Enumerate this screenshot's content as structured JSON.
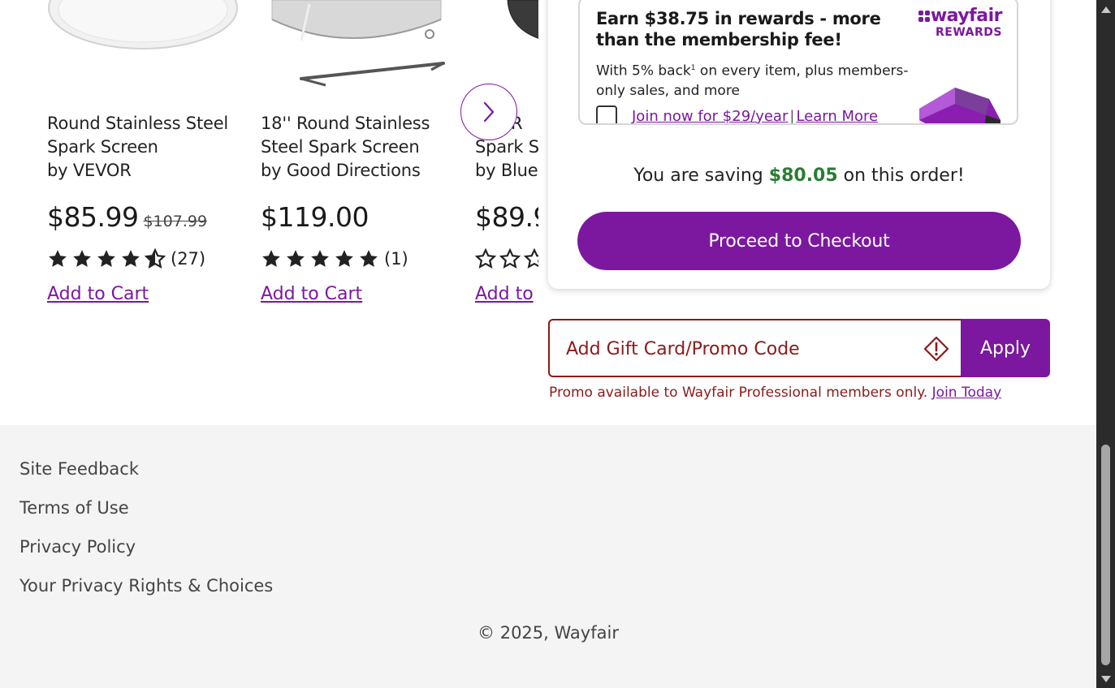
{
  "products": [
    {
      "name_line1": "Round Stainless Steel",
      "name_line2": "Spark Screen",
      "brand": "by VEVOR",
      "price": "$85.99",
      "was_price": "$107.99",
      "rating": 4.5,
      "review_count": "(27)",
      "add_label": "Add to Cart"
    },
    {
      "name_line1": "18'' Round Stainless",
      "name_line2": "Steel Spark Screen",
      "brand": "by Good Directions",
      "price": "$119.00",
      "was_price": "",
      "rating": 5,
      "review_count": "(1)",
      "add_label": "Add to Cart"
    },
    {
      "name_line1": "35'' R",
      "name_line2": "Spark S",
      "brand": "by Blue",
      "price": "$89.9",
      "was_price": "",
      "rating": 0,
      "review_count": "",
      "add_label": "Add to"
    }
  ],
  "carousel": {
    "next_icon": "chevron-right-icon"
  },
  "rewards": {
    "headline": "Earn $38.75 in rewards - more than the membership fee!",
    "desc_part1": "With 5% back",
    "desc_sup": "1",
    "desc_part2": " on every item, plus members-only sales, and more",
    "join_link": "Join now for $29/year",
    "separator": "|",
    "learn_more": "Learn More",
    "logo_word": "wayfair",
    "logo_sub": "REWARDS"
  },
  "summary": {
    "saving_prefix": "You are saving ",
    "saving_amount": "$80.05",
    "saving_suffix": " on this order!",
    "checkout_label": "Proceed to Checkout"
  },
  "promo": {
    "placeholder": "Add Gift Card/Promo Code",
    "apply_label": "Apply",
    "message": "Promo available to Wayfair Professional members only. ",
    "join_today": "Join Today"
  },
  "footer": {
    "links": [
      "Site Feedback",
      "Terms of Use",
      "Privacy Policy",
      "Your Privacy Rights & Choices"
    ],
    "copyright": "© 2025, Wayfair"
  },
  "colors": {
    "brand_purple": "#7b189f",
    "saving_green": "#2a7d34",
    "error_red": "#8b1a1a"
  }
}
